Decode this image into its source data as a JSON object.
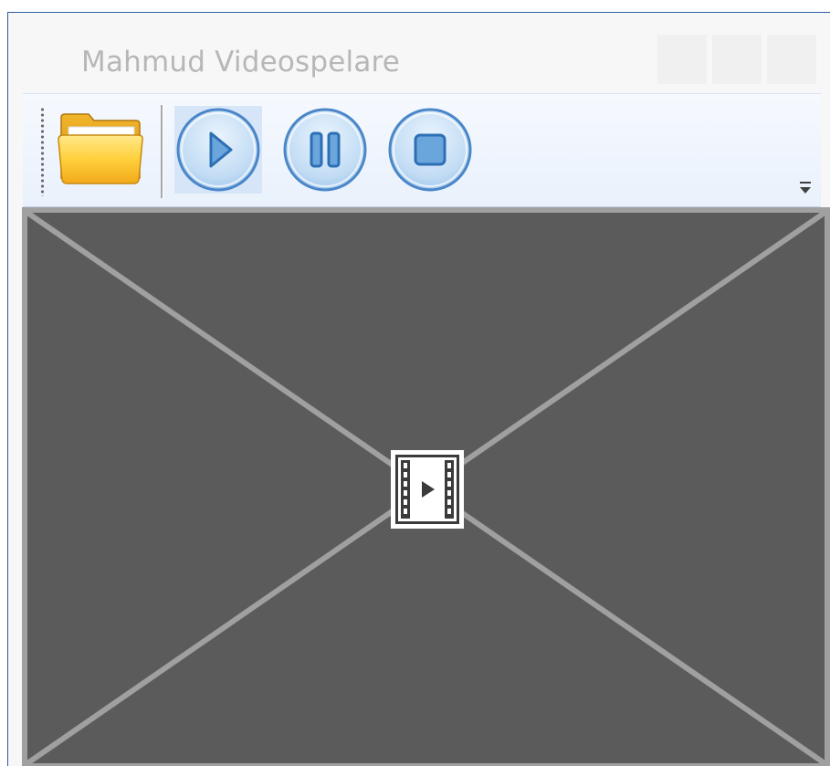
{
  "window": {
    "title": "Mahmud Videospelare"
  },
  "caption_buttons": [
    {
      "name": "minimize",
      "icon": "minimize-icon"
    },
    {
      "name": "maximize",
      "icon": "maximize-icon"
    },
    {
      "name": "close",
      "icon": "close-icon"
    }
  ],
  "toolbar": {
    "items": [
      {
        "name": "open",
        "icon": "folder-icon"
      },
      {
        "name": "play",
        "icon": "play-icon",
        "state": "hovered"
      },
      {
        "name": "pause",
        "icon": "pause-icon"
      },
      {
        "name": "stop",
        "icon": "stop-icon"
      }
    ],
    "overflow_icon": "toolbar-overflow-icon"
  },
  "video": {
    "placeholder_icon": "video-placeholder-icon",
    "background": "#5b5b5b",
    "border": "#a0a0a0"
  },
  "colors": {
    "window_border": "#2d5aa0",
    "title_text": "#b7b7b7",
    "button_blue": "#4a86c8",
    "folder_yellow": "#f7c830"
  }
}
